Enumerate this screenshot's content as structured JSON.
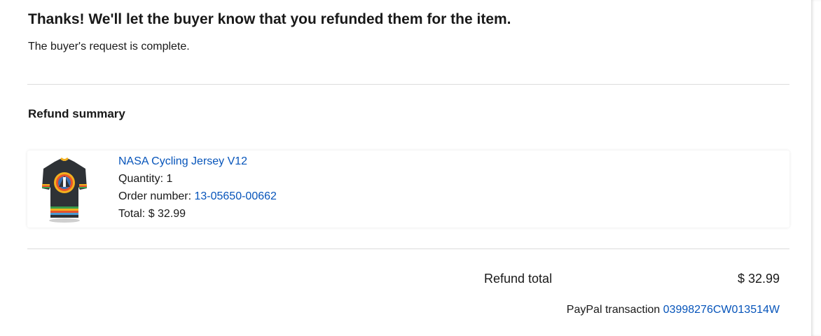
{
  "confirmation": {
    "headline": "Thanks! We'll let the buyer know that you refunded them for the item.",
    "subline": "The buyer's request is complete."
  },
  "refund_summary": {
    "title": "Refund summary",
    "item": {
      "name": "NASA Cycling Jersey V12",
      "image_icon": "jersey-image",
      "quantity_label": "Quantity: ",
      "quantity_value": "1",
      "order_label": "Order number: ",
      "order_number": "13-05650-00662",
      "total_label": "Total: ",
      "total_value": "$ 32.99"
    }
  },
  "totals": {
    "refund_total_label": "Refund total",
    "refund_total_value": "$ 32.99",
    "paypal_label": "PayPal transaction ",
    "paypal_transaction_id": "03998276CW013514W"
  },
  "colors": {
    "link": "#0654ba",
    "text": "#191919",
    "divider": "#dcdcdc"
  }
}
